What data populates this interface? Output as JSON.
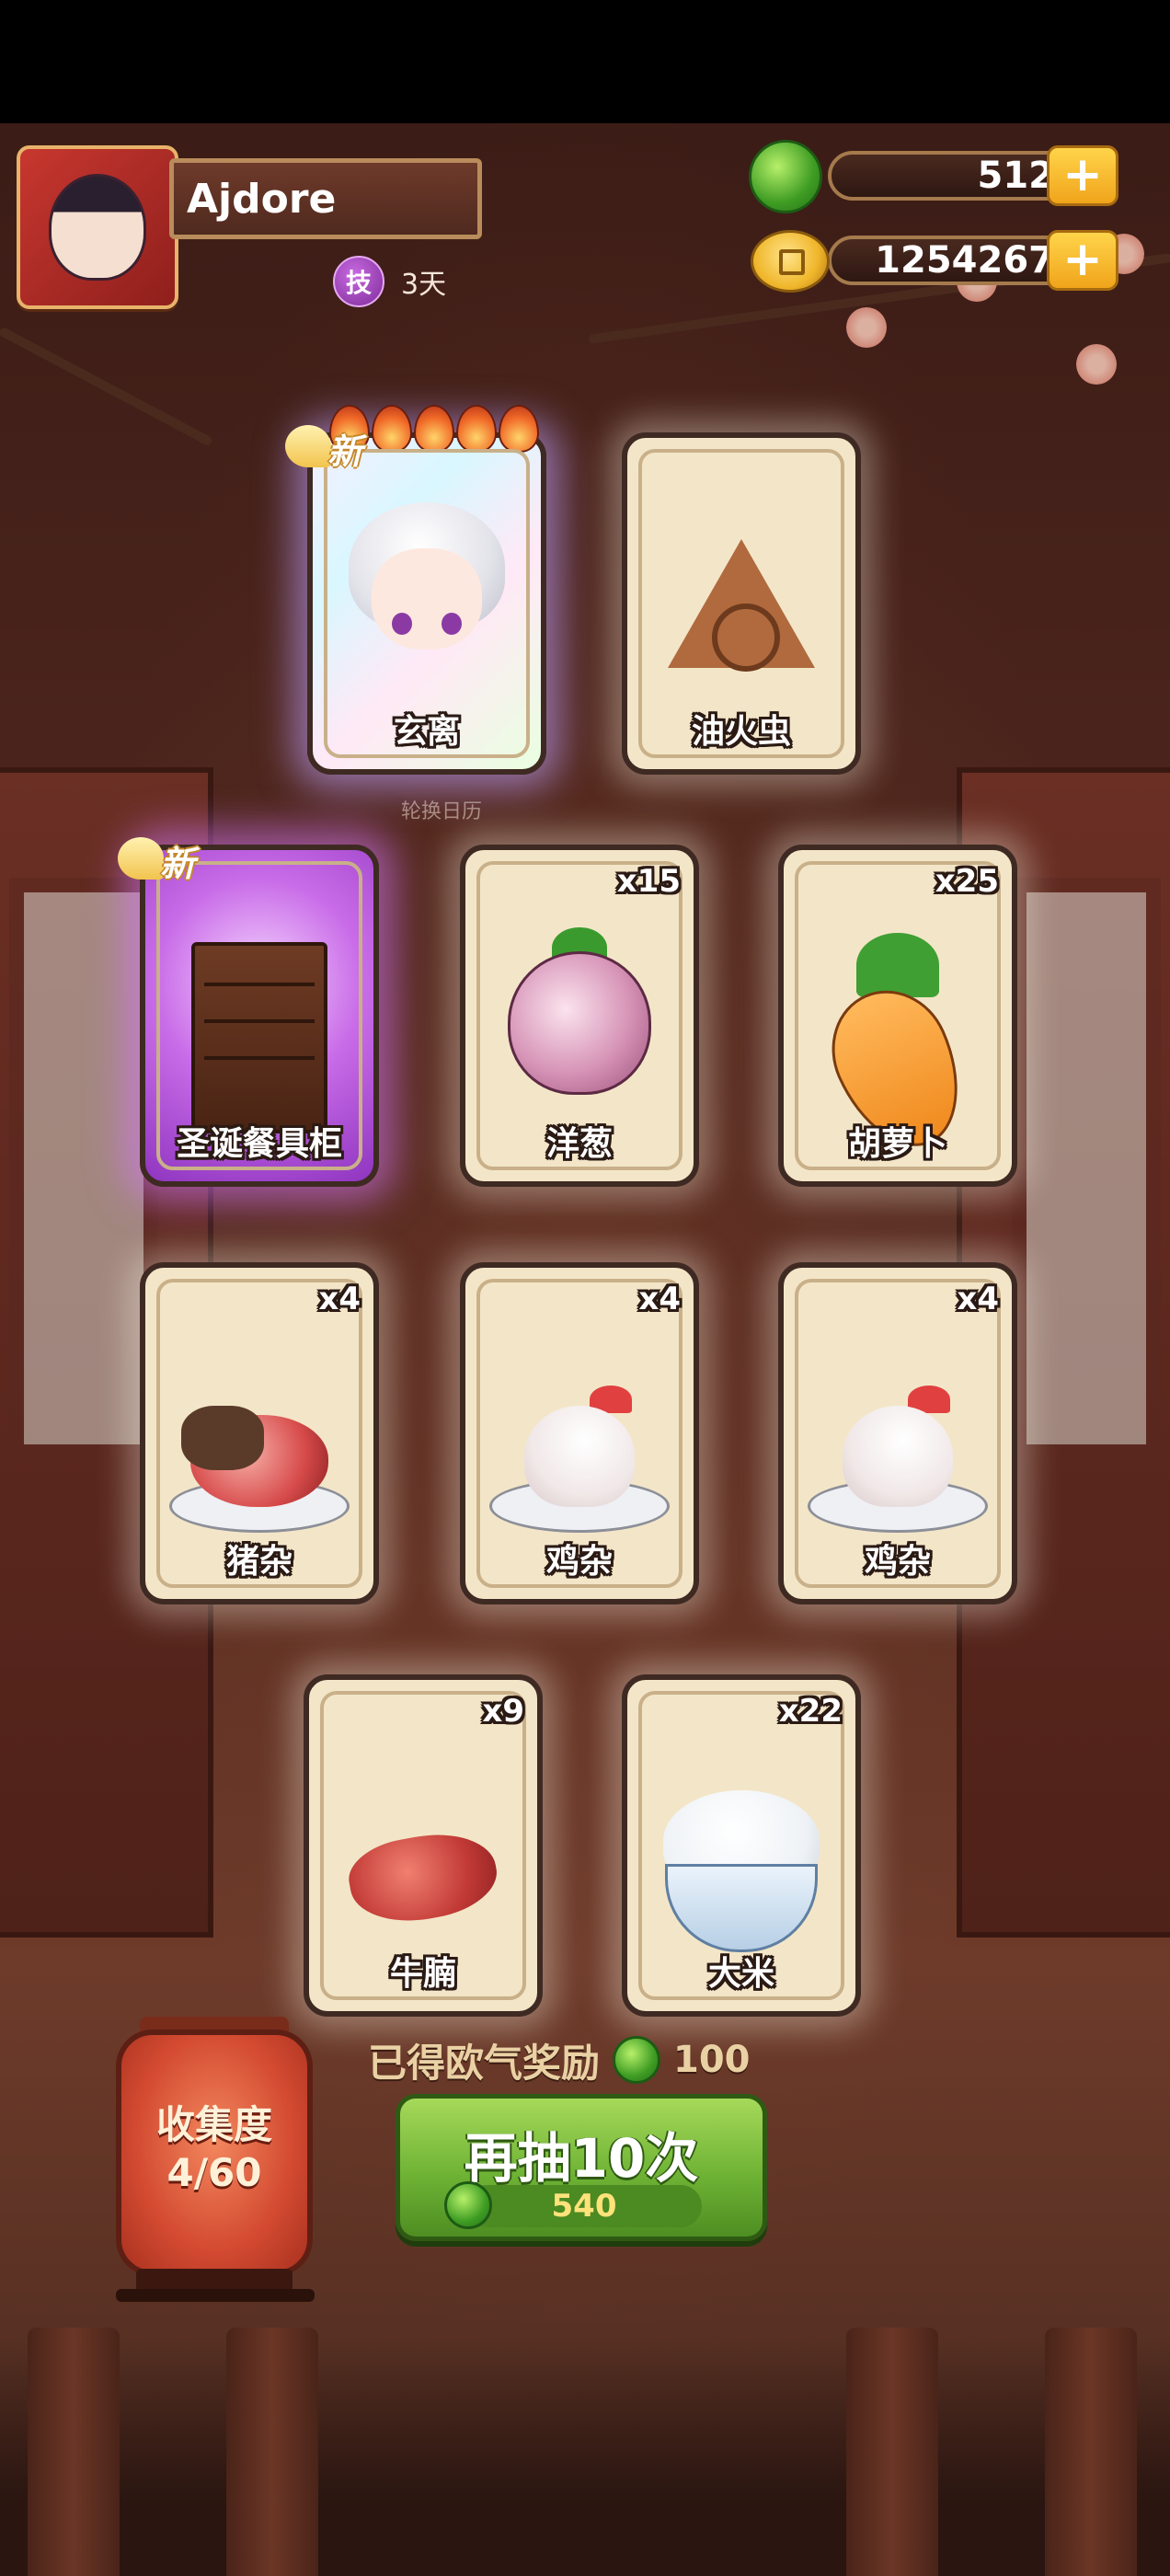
{
  "player": {
    "name": "Ajdore",
    "skill_badge": "技",
    "skill_days": "3天"
  },
  "resources": {
    "jade": {
      "icon": "jade-coin-icon",
      "value": "512",
      "add_label": "+"
    },
    "gold": {
      "icon": "gold-coin-icon",
      "value": "1254267",
      "add_label": "+"
    }
  },
  "calendar_label": "轮换日历",
  "new_tag": "新",
  "cards": [
    {
      "name": "玄离",
      "count": "",
      "is_new": true,
      "stars": 5,
      "style": "rainbow",
      "art": "character"
    },
    {
      "name": "油火虫",
      "count": "",
      "is_new": false,
      "style": "normal",
      "art": "triangle"
    },
    {
      "name": "圣诞餐具柜",
      "count": "",
      "is_new": true,
      "style": "rare",
      "art": "cabinet"
    },
    {
      "name": "洋葱",
      "count": "x15",
      "is_new": false,
      "style": "normal",
      "art": "onion"
    },
    {
      "name": "胡萝卜",
      "count": "x25",
      "is_new": false,
      "style": "normal",
      "art": "carrot"
    },
    {
      "name": "猪杂",
      "count": "x4",
      "is_new": false,
      "style": "normal",
      "art": "pork"
    },
    {
      "name": "鸡杂",
      "count": "x4",
      "is_new": false,
      "style": "normal",
      "art": "chicken"
    },
    {
      "name": "鸡杂",
      "count": "x4",
      "is_new": false,
      "style": "normal",
      "art": "chicken"
    },
    {
      "name": "牛腩",
      "count": "x9",
      "is_new": false,
      "style": "normal",
      "art": "beef"
    },
    {
      "name": "大米",
      "count": "x22",
      "is_new": false,
      "style": "normal",
      "art": "rice"
    }
  ],
  "collection": {
    "label": "收集度",
    "progress": "4/60"
  },
  "reward": {
    "label": "已得欧气奖励",
    "value": "100"
  },
  "draw_button": {
    "label": "再抽10次",
    "cost": "540"
  },
  "colors": {
    "draw_green": "#6fb335",
    "gold_plus": "#f0a41b",
    "rare_purple": "#c96ce8",
    "card_bg": "#f3e6c8"
  }
}
